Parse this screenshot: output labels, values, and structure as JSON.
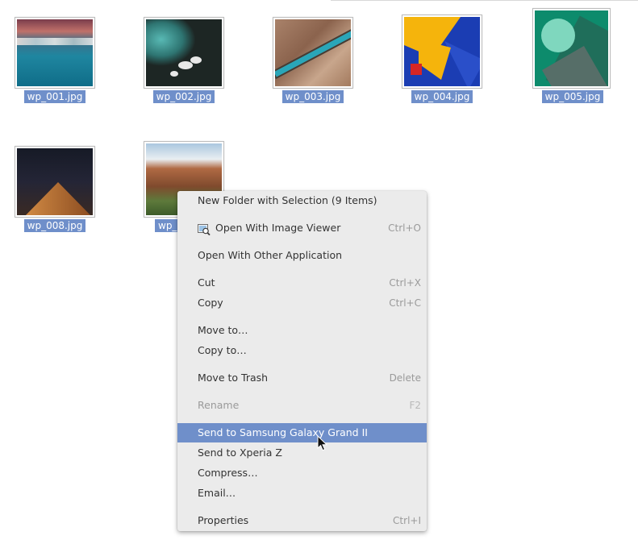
{
  "files": [
    {
      "name": "wp_001.jpg"
    },
    {
      "name": "wp_002.jpg"
    },
    {
      "name": "wp_003.jpg"
    },
    {
      "name": "wp_004.jpg"
    },
    {
      "name": "wp_005.jpg"
    },
    {
      "name": "wp_008.jpg"
    },
    {
      "name": "wp_"
    }
  ],
  "context_menu": {
    "items": [
      {
        "label": "New Folder with Selection (9 Items)",
        "shortcut": ""
      },
      {
        "label": "Open With Image Viewer",
        "shortcut": "Ctrl+O",
        "icon": "image-viewer-icon"
      },
      {
        "label": "Open With Other Application",
        "shortcut": ""
      },
      {
        "label": "Cut",
        "shortcut": "Ctrl+X"
      },
      {
        "label": "Copy",
        "shortcut": "Ctrl+C"
      },
      {
        "label": "Move to…",
        "shortcut": ""
      },
      {
        "label": "Copy to…",
        "shortcut": ""
      },
      {
        "label": "Move to Trash",
        "shortcut": "Delete"
      },
      {
        "label": "Rename",
        "shortcut": "F2",
        "disabled": true
      },
      {
        "label": "Send to Samsung Galaxy Grand II",
        "shortcut": "",
        "highlighted": true
      },
      {
        "label": "Send to Xperia Z",
        "shortcut": ""
      },
      {
        "label": "Compress…",
        "shortcut": ""
      },
      {
        "label": "Email…",
        "shortcut": ""
      },
      {
        "label": "Properties",
        "shortcut": "Ctrl+I"
      }
    ]
  },
  "colors": {
    "selection": "#6f8fca",
    "menu_background": "#ebebeb",
    "shortcut_text": "#9a9a9a"
  }
}
